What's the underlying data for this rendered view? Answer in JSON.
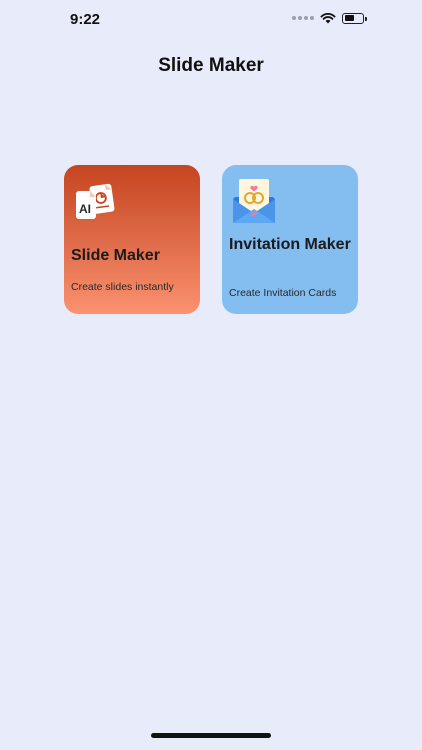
{
  "status_bar": {
    "time": "9:22"
  },
  "header": {
    "title": "Slide Maker"
  },
  "cards": [
    {
      "title": "Slide Maker",
      "subtitle": "Create slides instantly",
      "icon": "ai-document-icon",
      "icon_text": "AI",
      "gradient": [
        "#c64520",
        "#fb9270"
      ]
    },
    {
      "title": "Invitation Maker",
      "subtitle": "Create Invitation Cards",
      "icon": "invitation-envelope-icon",
      "color": "#84bef1"
    }
  ],
  "colors": {
    "background": "#e8ebfa"
  }
}
